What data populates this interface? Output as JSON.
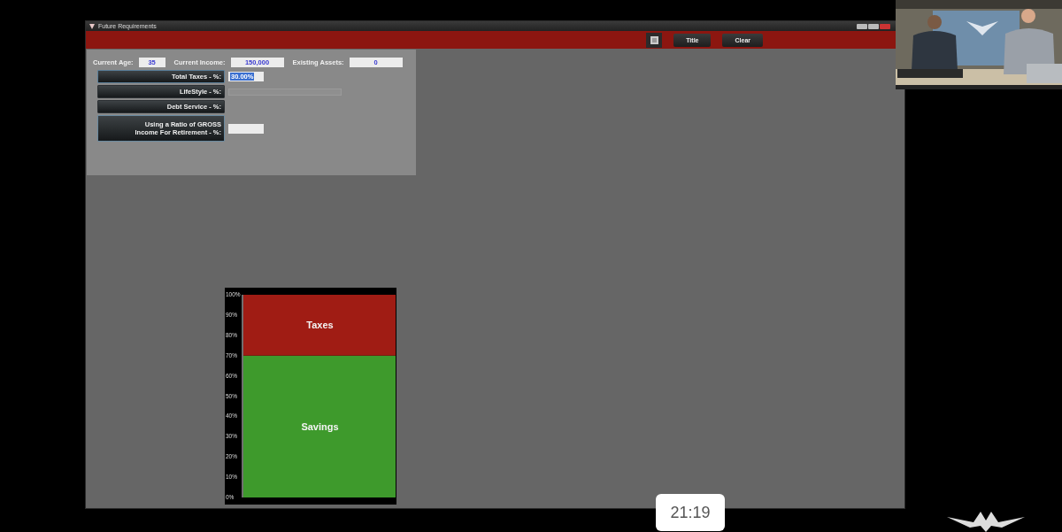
{
  "window": {
    "title": "Future Requirements"
  },
  "toolbar": {
    "buttons": [
      "Title",
      "Clear"
    ]
  },
  "fields": [
    {
      "label": "Current Age:",
      "value": "35"
    },
    {
      "label": "Current Income:",
      "value": "150,000"
    },
    {
      "label": "Existing Assets:",
      "value": "0"
    }
  ],
  "rows": [
    {
      "label": "Total Taxes - %:",
      "kind": "input",
      "value": "30.00%",
      "highlighted": true
    },
    {
      "label": "LifeStyle - %:",
      "kind": "bar"
    },
    {
      "label": "Debt Service - %:",
      "kind": "none"
    },
    {
      "label": "Using a Ratio of GROSS Income For Retirement - %:",
      "kind": "input"
    }
  ],
  "chart": {
    "chart_data": {
      "type": "bar",
      "stacked": true,
      "ylim": [
        0,
        100
      ],
      "yticks": [
        {
          "value": 0,
          "label": "0%"
        },
        {
          "value": 10,
          "label": "10%"
        },
        {
          "value": 20,
          "label": "20%"
        },
        {
          "value": 30,
          "label": "30%"
        },
        {
          "value": 40,
          "label": "40%"
        },
        {
          "value": 50,
          "label": "50%"
        },
        {
          "value": 60,
          "label": "60%"
        },
        {
          "value": 70,
          "label": "70%"
        },
        {
          "value": 80,
          "label": "80%"
        },
        {
          "value": 90,
          "label": "90%"
        },
        {
          "value": 100,
          "label": "100%"
        }
      ],
      "series": [
        {
          "name": "Savings",
          "color": "#3e9a2c",
          "values": [
            70
          ]
        },
        {
          "name": "Taxes",
          "color": "#a01c14",
          "values": [
            30
          ]
        }
      ]
    }
  },
  "overlay": {
    "time": "21:19"
  }
}
